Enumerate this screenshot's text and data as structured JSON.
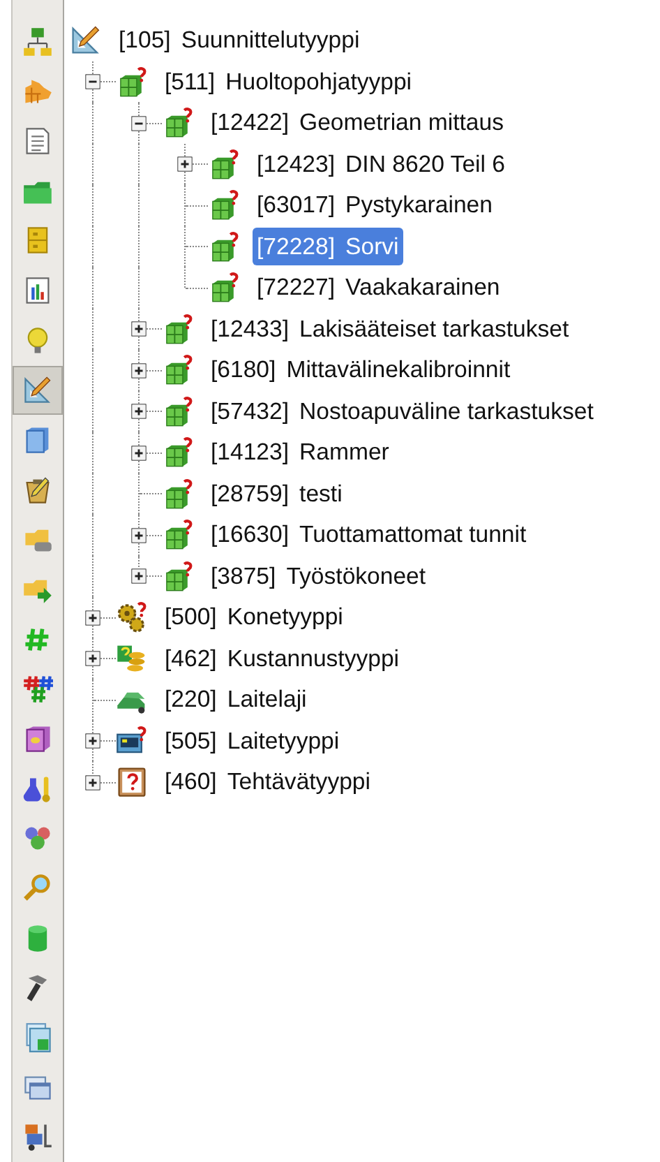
{
  "toolbar": {
    "items": [
      {
        "selected": false
      },
      {
        "selected": false
      },
      {
        "selected": false
      },
      {
        "selected": false
      },
      {
        "selected": false
      },
      {
        "selected": false
      },
      {
        "selected": false
      },
      {
        "selected": true
      },
      {
        "selected": false
      },
      {
        "selected": false
      },
      {
        "selected": false
      },
      {
        "selected": false
      },
      {
        "selected": false
      },
      {
        "selected": false
      },
      {
        "selected": false
      },
      {
        "selected": false
      },
      {
        "selected": false
      },
      {
        "selected": false
      },
      {
        "selected": false
      },
      {
        "selected": false
      },
      {
        "selected": false
      },
      {
        "selected": false
      },
      {
        "selected": false
      }
    ]
  },
  "tree": {
    "root": {
      "code": "[105]",
      "label": "Suunnittelutyyppi",
      "kind": "design",
      "selected": false,
      "children": [
        {
          "code": "[511]",
          "label": "Huoltopohjatyyppi",
          "kind": "type",
          "expanded": true,
          "selected": false,
          "children": [
            {
              "code": "[12422]",
              "label": "Geometrian mittaus",
              "kind": "type",
              "expanded": true,
              "selected": false,
              "children": [
                {
                  "code": "[12423]",
                  "label": "DIN 8620 Teil 6",
                  "kind": "type",
                  "expanded": false,
                  "selected": false
                },
                {
                  "code": "[63017]",
                  "label": "Pystykarainen",
                  "kind": "type",
                  "selected": false
                },
                {
                  "code": "[72228]",
                  "label": "Sorvi",
                  "kind": "type",
                  "selected": true
                },
                {
                  "code": "[72227]",
                  "label": "Vaakakarainen",
                  "kind": "type",
                  "selected": false
                }
              ]
            },
            {
              "code": "[12433]",
              "label": "Lakisääteiset tarkastukset",
              "kind": "type",
              "expanded": false,
              "selected": false
            },
            {
              "code": "[6180]",
              "label": "Mittavälinekalibroinnit",
              "kind": "type",
              "expanded": false,
              "selected": false
            },
            {
              "code": "[57432]",
              "label": "Nostoapuväline tarkastukset",
              "kind": "type",
              "expanded": false,
              "selected": false
            },
            {
              "code": "[14123]",
              "label": "Rammer",
              "kind": "type",
              "expanded": false,
              "selected": false
            },
            {
              "code": "[28759]",
              "label": "testi",
              "kind": "type",
              "selected": false
            },
            {
              "code": "[16630]",
              "label": "Tuottamattomat tunnit",
              "kind": "type",
              "expanded": false,
              "selected": false
            },
            {
              "code": "[3875]",
              "label": "Työstökoneet",
              "kind": "type",
              "expanded": false,
              "selected": false
            }
          ]
        },
        {
          "code": "[500]",
          "label": "Konetyyppi",
          "kind": "gear",
          "expanded": false,
          "selected": false
        },
        {
          "code": "[462]",
          "label": "Kustannustyyppi",
          "kind": "money",
          "expanded": false,
          "selected": false
        },
        {
          "code": "[220]",
          "label": "Laitelaji",
          "kind": "vehicle",
          "selected": false
        },
        {
          "code": "[505]",
          "label": "Laitetyyppi",
          "kind": "device",
          "expanded": false,
          "selected": false
        },
        {
          "code": "[460]",
          "label": "Tehtävätyyppi",
          "kind": "clipboard",
          "expanded": false,
          "selected": false
        }
      ]
    }
  }
}
